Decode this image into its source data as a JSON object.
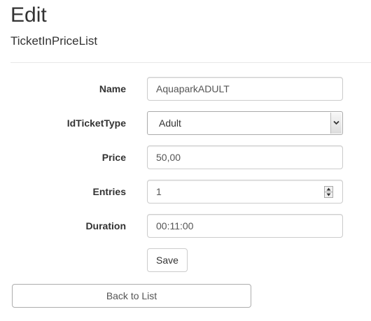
{
  "header": {
    "title": "Edit",
    "subtitle": "TicketInPriceList"
  },
  "form": {
    "name": {
      "label": "Name",
      "value": "AquaparkADULT"
    },
    "id_ticket_type": {
      "label": "IdTicketType",
      "selected": "Adult"
    },
    "price": {
      "label": "Price",
      "value": "50,00"
    },
    "entries": {
      "label": "Entries",
      "value": "1"
    },
    "duration": {
      "label": "Duration",
      "value": "00:11:00"
    },
    "save_label": "Save"
  },
  "footer": {
    "back_label": "Back to List"
  },
  "icons": {
    "select_arrow": "chevron-down-icon",
    "spin_up": "spin-up-icon",
    "spin_down": "spin-down-icon"
  }
}
